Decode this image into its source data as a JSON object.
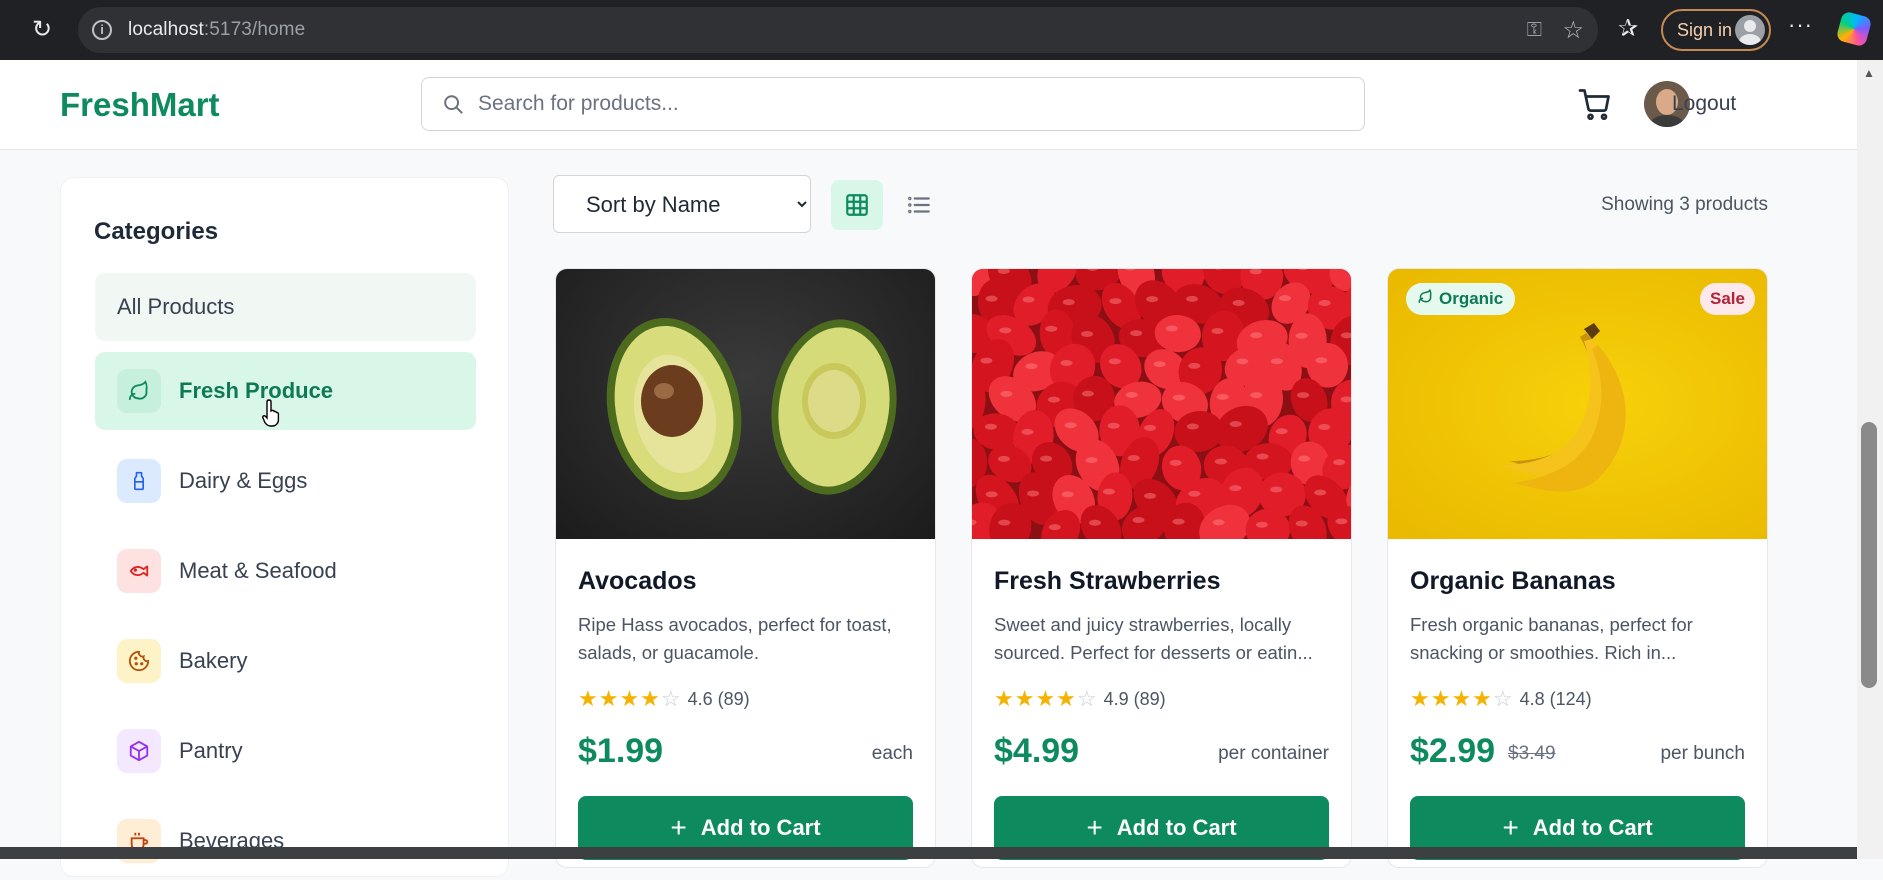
{
  "browser": {
    "url_host": "localhost",
    "url_rest": ":5173/home",
    "signin_label": "Sign in"
  },
  "header": {
    "logo": "FreshMart",
    "search_placeholder": "Search for products...",
    "logout_label": "Logout"
  },
  "sidebar": {
    "title": "Categories",
    "all_label": "All Products",
    "items": [
      {
        "label": "Fresh Produce",
        "icon": "leaf-icon",
        "active": true
      },
      {
        "label": "Dairy & Eggs",
        "icon": "milk-bottle-icon"
      },
      {
        "label": "Meat & Seafood",
        "icon": "fish-icon"
      },
      {
        "label": "Bakery",
        "icon": "cookie-icon"
      },
      {
        "label": "Pantry",
        "icon": "box-icon"
      },
      {
        "label": "Beverages",
        "icon": "coffee-cup-icon"
      }
    ]
  },
  "toolbar": {
    "sort_selected": "Sort by Name",
    "showing": "Showing 3 products"
  },
  "products": [
    {
      "name": "Avocados",
      "desc": "Ripe Hass avocados, perfect for toast, salads, or guacamole.",
      "rating": "4.6 (89)",
      "stars": 4,
      "price": "$1.99",
      "old_price": "",
      "unit": "each",
      "button": "Add to Cart"
    },
    {
      "name": "Fresh Strawberries",
      "desc": "Sweet and juicy strawberries, locally sourced. Perfect for desserts or eatin...",
      "rating": "4.9 (89)",
      "stars": 4,
      "price": "$4.99",
      "old_price": "",
      "unit": "per container",
      "button": "Add to Cart"
    },
    {
      "name": "Organic Bananas",
      "desc": "Fresh organic bananas, perfect for snacking or smoothies. Rich in...",
      "rating": "4.8 (124)",
      "stars": 4,
      "price": "$2.99",
      "old_price": "$3.49",
      "unit": "per bunch",
      "button": "Add to Cart",
      "badge_organic": "Organic",
      "badge_sale": "Sale"
    }
  ],
  "colors": {
    "brand": "#0e8a5f",
    "active_bg": "#d9f7e8",
    "star": "#f5b301"
  }
}
